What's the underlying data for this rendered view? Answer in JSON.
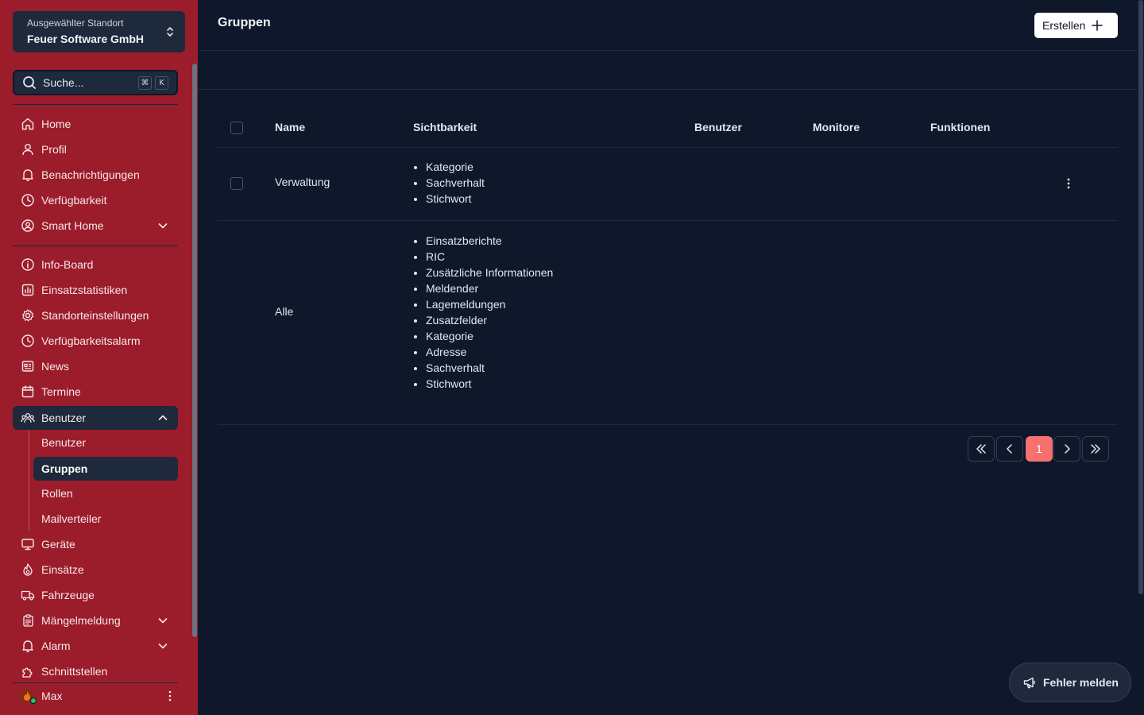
{
  "location": {
    "label": "Ausgewählter Standort",
    "name": "Feuer Software GmbH"
  },
  "search": {
    "placeholder": "Suche...",
    "shortcut_mod": "⌘",
    "shortcut_key": "K"
  },
  "nav": {
    "home": "Home",
    "profil": "Profil",
    "benachrichtigungen": "Benachrichtigungen",
    "verfuegbarkeit": "Verfügbarkeit",
    "smart_home": "Smart Home",
    "info_board": "Info-Board",
    "einsatzstatistiken": "Einsatzstatistiken",
    "standorteinstellungen": "Standorteinstellungen",
    "verfuegbarkeitsalarm": "Verfügbarkeitsalarm",
    "news": "News",
    "termine": "Termine",
    "benutzer": "Benutzer",
    "sub_benutzer": "Benutzer",
    "sub_gruppen": "Gruppen",
    "sub_rollen": "Rollen",
    "sub_mailverteiler": "Mailverteiler",
    "geraete": "Geräte",
    "einsaetze": "Einsätze",
    "fahrzeuge": "Fahrzeuge",
    "maengelmeldung": "Mängelmeldung",
    "alarm": "Alarm",
    "schnittstellen": "Schnittstellen"
  },
  "user": {
    "name": "Max"
  },
  "header": {
    "title": "Gruppen",
    "create_label": "Erstellen"
  },
  "table": {
    "columns": {
      "name": "Name",
      "sichtbarkeit": "Sichtbarkeit",
      "benutzer": "Benutzer",
      "monitore": "Monitore",
      "funktionen": "Funktionen"
    },
    "rows": [
      {
        "name": "Verwaltung",
        "sichtbarkeit": [
          "Kategorie",
          "Sachverhalt",
          "Stichwort"
        ]
      },
      {
        "name": "Alle",
        "sichtbarkeit": [
          "Einsatzberichte",
          "RIC",
          "Zusätzliche Informationen",
          "Meldender",
          "Lagemeldungen",
          "Zusatzfelder",
          "Kategorie",
          "Adresse",
          "Sachverhalt",
          "Stichwort"
        ]
      }
    ]
  },
  "pagination": {
    "current_page": "1"
  },
  "report_button": "Fehler melden",
  "colors": {
    "sidebar": "#9b1c2a",
    "background": "#0f172a",
    "panel": "#1e293b",
    "accent": "#f87171"
  }
}
